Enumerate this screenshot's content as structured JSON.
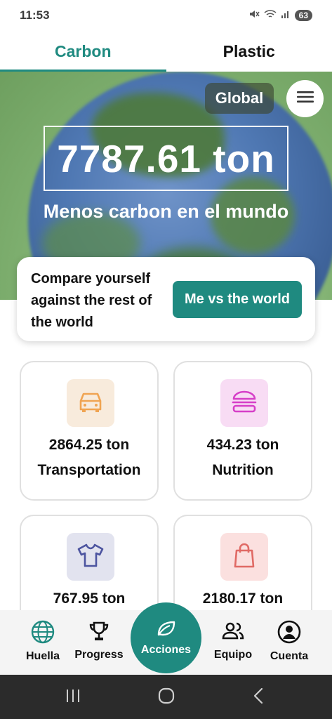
{
  "status": {
    "time": "11:53",
    "battery": "63"
  },
  "tabs": [
    {
      "label": "Carbon",
      "active": true
    },
    {
      "label": "Plastic",
      "active": false
    }
  ],
  "hero": {
    "region_label": "Global",
    "total": "7787.61 ton",
    "subtitle": "Menos carbon en el mundo"
  },
  "compare": {
    "text": "Compare yourself against the rest of the world",
    "button_label": "Me vs the world"
  },
  "categories": [
    {
      "value": "2864.25 ton",
      "label": "Transportation",
      "icon": "car-icon",
      "icon_bg": "#f8ebdc",
      "icon_color": "#f0a452"
    },
    {
      "value": "434.23 ton",
      "label": "Nutrition",
      "icon": "burger-icon",
      "icon_bg": "#f8dcf4",
      "icon_color": "#d63fc8"
    },
    {
      "value": "767.95 ton",
      "label": "",
      "icon": "shirt-icon",
      "icon_bg": "#e2e3ef",
      "icon_color": "#4d55a0"
    },
    {
      "value": "2180.17 ton",
      "label": "",
      "icon": "shopping-bag-icon",
      "icon_bg": "#fbe0df",
      "icon_color": "#e06a65"
    }
  ],
  "nav": {
    "huella": "Huella",
    "progress": "Progress",
    "acciones": "Acciones",
    "equipo": "Equipo",
    "cuenta": "Cuenta"
  },
  "colors": {
    "accent": "#1f8a80"
  }
}
